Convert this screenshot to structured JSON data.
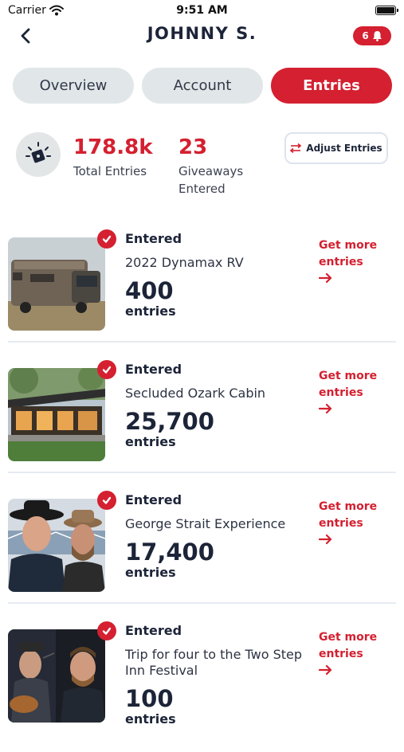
{
  "status_bar": {
    "carrier": "Carrier",
    "time": "9:51 AM"
  },
  "header": {
    "title": "JOHNNY S.",
    "notification_count": "6"
  },
  "tabs": [
    {
      "label": "Overview",
      "active": false
    },
    {
      "label": "Account",
      "active": false
    },
    {
      "label": "Entries",
      "active": true
    }
  ],
  "summary": {
    "total_entries": "178.8k",
    "total_entries_label": "Total Entries",
    "giveaways": "23",
    "giveaways_label": "Giveaways Entered",
    "adjust_label": "Adjust Entries"
  },
  "items": [
    {
      "status": "Entered",
      "name": "2022 Dynamax RV",
      "count": "400",
      "count_label": "entries",
      "cta": "Get more entries"
    },
    {
      "status": "Entered",
      "name": "Secluded Ozark Cabin",
      "count": "25,700",
      "count_label": "entries",
      "cta": "Get more entries"
    },
    {
      "status": "Entered",
      "name": "George Strait Experience",
      "count": "17,400",
      "count_label": "entries",
      "cta": "Get more entries"
    },
    {
      "status": "Entered",
      "name": "Trip for four to the Two Step Inn Festival",
      "count": "100",
      "count_label": "entries",
      "cta": "Get more entries"
    }
  ],
  "colors": {
    "accent": "#d42030",
    "navy": "#1c2438",
    "tab_inactive": "#e1e7e8"
  },
  "icons": [
    "wifi-icon",
    "battery-icon",
    "back-chevron-icon",
    "bell-icon",
    "ticket-burst-icon",
    "sliders-icon",
    "check-icon",
    "arrow-right-icon"
  ]
}
